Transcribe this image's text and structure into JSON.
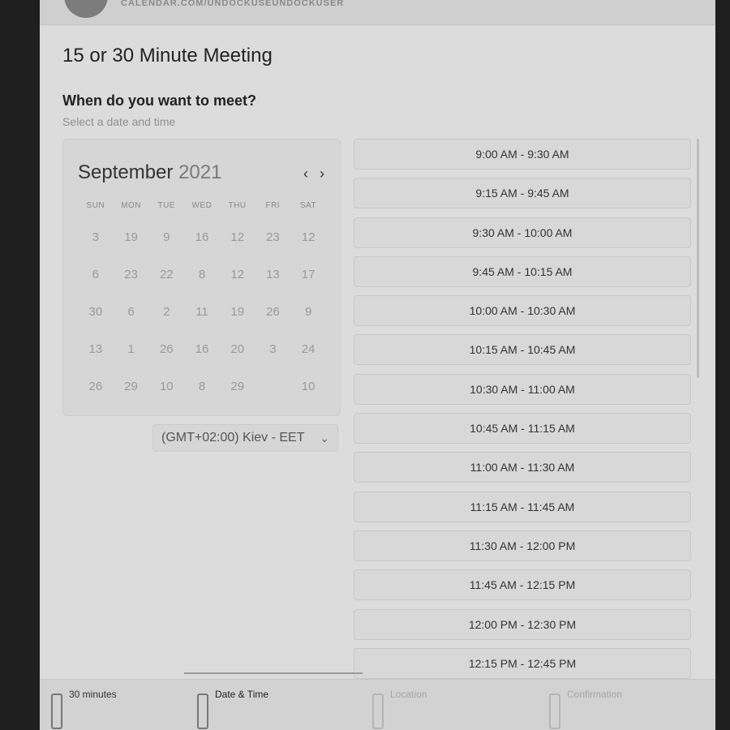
{
  "header": {
    "url": "CALENDAR.COM/UNDOCKUSEUNDOCKUSER"
  },
  "event": {
    "title": "15 or 30 Minute Meeting"
  },
  "scheduler": {
    "question": "When do you want to meet?",
    "hint": "Select a date and time"
  },
  "calendar": {
    "month": "September",
    "year": "2021",
    "prev_icon": "chevron-left-icon",
    "next_icon": "chevron-right-icon",
    "prev_label": "‹",
    "next_label": "›",
    "weekdays": [
      "SUN",
      "MON",
      "TUE",
      "WED",
      "THU",
      "FRI",
      "SAT"
    ],
    "weeks": [
      [
        "3",
        "19",
        "9",
        "16",
        "12",
        "23",
        "12"
      ],
      [
        "6",
        "23",
        "22",
        "8",
        "12",
        "13",
        "17"
      ],
      [
        "30",
        "6",
        "2",
        "11",
        "19",
        "26",
        "9"
      ],
      [
        "13",
        "1",
        "26",
        "16",
        "20",
        "3",
        "24"
      ],
      [
        "26",
        "29",
        "10",
        "8",
        "29",
        "",
        "10"
      ]
    ]
  },
  "timezone": {
    "value": "(GMT+02:00) Kiev - EET",
    "icon": "chevron-down-icon",
    "chevron": "⌄"
  },
  "time_slots": [
    "9:00 AM - 9:30 AM",
    "9:15 AM - 9:45 AM",
    "9:30 AM - 10:00 AM",
    "9:45 AM - 10:15 AM",
    "10:00 AM - 10:30 AM",
    "10:15 AM - 10:45 AM",
    "10:30 AM - 11:00 AM",
    "10:45 AM - 11:15 AM",
    "11:00 AM - 11:30 AM",
    "11:15 AM - 11:45 AM",
    "11:30 AM - 12:00 PM",
    "11:45 AM - 12:15 PM",
    "12:00 PM - 12:30 PM",
    "12:15 PM - 12:45 PM"
  ],
  "footer": {
    "steps": [
      {
        "label": "30 minutes",
        "state": "done"
      },
      {
        "label": "Date & Time",
        "state": "active"
      },
      {
        "label": "Location",
        "state": "pending"
      },
      {
        "label": "Confirmation",
        "state": "pending"
      }
    ]
  },
  "colors": {
    "page_background": "#dcdcdc",
    "outer_background": "#1f1f1f",
    "text_primary": "#222222",
    "text_muted": "#8f8f8f"
  }
}
